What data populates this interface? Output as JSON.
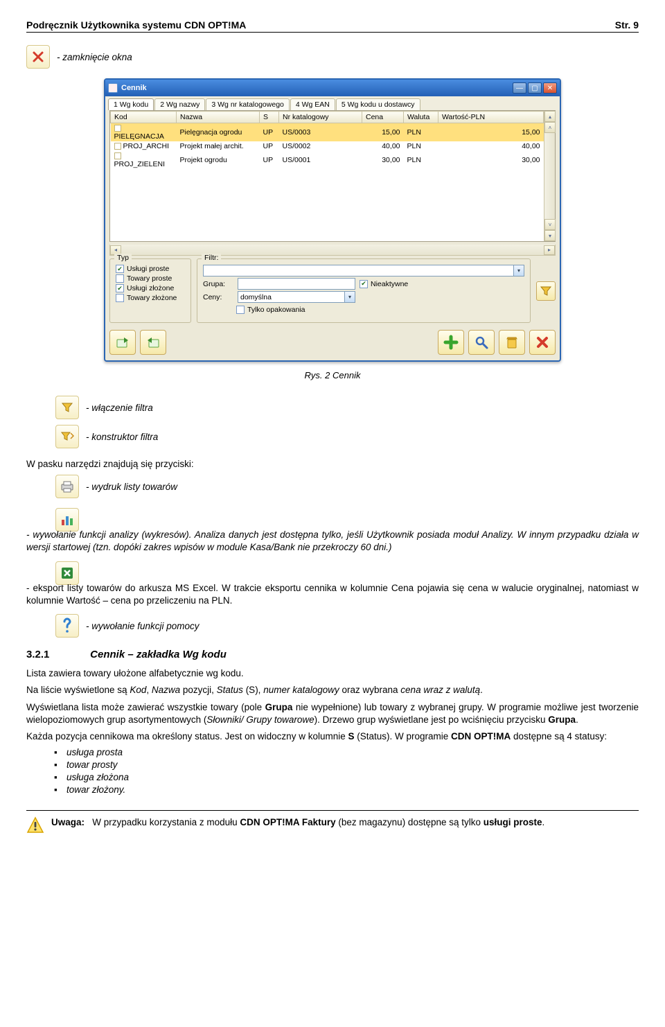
{
  "header": {
    "left": "Podręcznik Użytkownika systemu CDN OPT!MA",
    "right": "Str. 9"
  },
  "intro": {
    "close_label": "- zamknięcie okna"
  },
  "window": {
    "title": "Cennik",
    "tabs": [
      "1 Wg kodu",
      "2 Wg nazwy",
      "3 Wg nr katalogowego",
      "4 Wg EAN",
      "5 Wg kodu u dostawcy"
    ],
    "columns": [
      "Kod",
      "Nazwa",
      "S",
      "Nr katalogowy",
      "Cena",
      "Waluta",
      "Wartość-PLN"
    ],
    "rows": [
      {
        "kod": "PIELĘGNACJA",
        "nazwa": "Pielęgnacja ogrodu",
        "s": "UP",
        "nr": "US/0003",
        "cena": "15,00",
        "wal": "PLN",
        "wart": "15,00",
        "sel": true
      },
      {
        "kod": "PROJ_ARCHI",
        "nazwa": "Projekt małej archit.",
        "s": "UP",
        "nr": "US/0002",
        "cena": "40,00",
        "wal": "PLN",
        "wart": "40,00",
        "sel": false
      },
      {
        "kod": "PROJ_ZIELENI",
        "nazwa": "Projekt ogrodu",
        "s": "UP",
        "nr": "US/0001",
        "cena": "30,00",
        "wal": "PLN",
        "wart": "30,00",
        "sel": false
      }
    ],
    "typ_legend": "Typ",
    "typ_options": [
      {
        "label": "Usługi proste",
        "checked": true
      },
      {
        "label": "Towary proste",
        "checked": false
      },
      {
        "label": "Usługi złożone",
        "checked": true
      },
      {
        "label": "Towary złożone",
        "checked": false
      }
    ],
    "filtr_legend": "Filtr:",
    "grupa_label": "Grupa:",
    "ceny_label": "Ceny:",
    "ceny_value": "domyślna",
    "nieaktywne_label": "Nieaktywne",
    "tylko_opak_label": "Tylko opakowania"
  },
  "caption": "Rys. 2 Cennik",
  "items": {
    "filter_on": "- włączenie filtra",
    "filter_ctor": "- konstruktor filtra",
    "toolbar_intro": "W pasku narzędzi znajdują się przyciski:",
    "print": "- wydruk listy towarów",
    "analysis": "- wywołanie funkcji analizy (wykresów). Analiza danych jest dostępna tylko, jeśli Użytkownik posiada moduł Analizy. W innym przypadku działa w wersji startowej (tzn. dopóki zakres wpisów w module Kasa/Bank nie przekroczy 60 dni.)",
    "excel": "- eksport listy towarów do arkusza MS Excel. W trakcie eksportu cennika w kolumnie Cena pojawia się cena w walucie oryginalnej, natomiast w kolumnie Wartość – cena po przeliczeniu na PLN.",
    "help": "- wywołanie funkcji pomocy"
  },
  "section": {
    "num": "3.2.1",
    "title": "Cennik – zakładka Wg kodu"
  },
  "para": {
    "p1": "Lista zawiera towary ułożone alfabetycznie wg kodu.",
    "p2_a": "Na liście wyświetlone są ",
    "p2_kod": "Kod",
    "p2_b": ", ",
    "p2_nazwa": "Nazwa",
    "p2_c": " pozycji, ",
    "p2_status": "Status",
    "p2_d": " (S), ",
    "p2_nrkat": "numer katalogowy",
    "p2_e": " oraz wybrana ",
    "p2_cena": "cena wraz z walutą",
    "p2_f": ".",
    "p3_a": "Wyświetlana lista może zawierać wszystkie towary (pole ",
    "p3_grupa": "Grupa",
    "p3_b": " nie wypełnione) lub towary z wybranej grupy. W programie możliwe jest tworzenie wielopoziomowych grup asortymentowych (",
    "p3_sl": "Słowniki/ Grupy towarowe",
    "p3_c": "). Drzewo grup wyświetlane jest po wciśnięciu przycisku ",
    "p3_grupa2": "Grupa",
    "p3_d": ".",
    "p4_a": "Każda pozycja cennikowa ma określony status. Jest on widoczny w kolumnie ",
    "p4_s": "S",
    "p4_b": " (Status). W programie ",
    "p4_prod": "CDN OPT!MA",
    "p4_c": " dostępne są 4 statusy:"
  },
  "statuses": [
    "usługa prosta",
    "towar prosty",
    "usługa złożona",
    "towar złożony."
  ],
  "footer": {
    "uwaga": "Uwaga:",
    "text_a": "W przypadku korzystania z modułu ",
    "text_prod": "CDN OPT!MA Faktury",
    "text_b": " (bez magazynu) dostępne są tylko ",
    "text_c": "usługi proste",
    "text_d": "."
  }
}
